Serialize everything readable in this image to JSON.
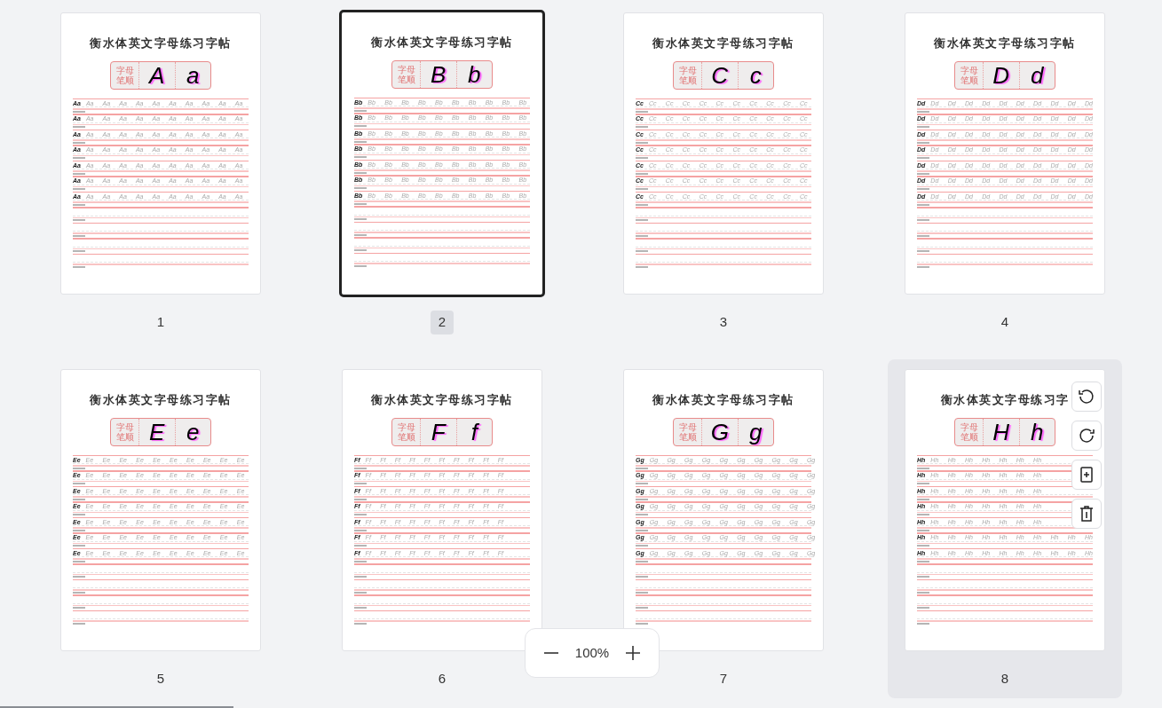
{
  "pages": [
    {
      "number": "1",
      "selected": false,
      "hovered": false,
      "title": "衡水体英文字母练习字帖",
      "stroke_label": [
        "字母",
        "笔顺"
      ],
      "upper": "A",
      "lower": "a",
      "rows": [
        {
          "model": "Aa",
          "traces": "Aa Aa Aa Aa Aa Aa Aa Aa Aa Aa"
        },
        {
          "model": "Aa",
          "traces": "Aa Aa Aa Aa Aa Aa Aa Aa Aa Aa"
        },
        {
          "model": "Aa",
          "traces": "Aa Aa Aa Aa Aa Aa Aa Aa Aa Aa"
        },
        {
          "model": "Aa",
          "traces": "Aa Aa Aa Aa Aa Aa Aa Aa Aa Aa"
        },
        {
          "model": "Aa",
          "traces": "Aa Aa Aa Aa Aa Aa Aa Aa Aa Aa"
        },
        {
          "model": "Aa",
          "traces": "Aa Aa Aa Aa Aa Aa Aa Aa Aa Aa"
        },
        {
          "model": "Aa",
          "traces": "Aa Aa Aa Aa Aa Aa Aa Aa Aa Aa"
        }
      ]
    },
    {
      "number": "2",
      "selected": true,
      "hovered": false,
      "title": "衡水体英文字母练习字帖",
      "stroke_label": [
        "字母",
        "笔顺"
      ],
      "upper": "B",
      "lower": "b",
      "rows": [
        {
          "model": "Bb",
          "traces": "Bb Bb Bb Bb Bb Bb Bb Bb Bb Bb"
        },
        {
          "model": "Bb",
          "traces": "Bb Bb Bb Bb Bb Bb Bb Bb Bb Bb"
        },
        {
          "model": "Bb",
          "traces": "Bb Bb Bb Bb Bb Bb Bb Bb Bb Bb"
        },
        {
          "model": "Bb",
          "traces": "Bb Bb Bb Bb Bb Bb Bb Bb Bb Bb"
        },
        {
          "model": "Bb",
          "traces": "Bb Bb Bb Bb Bb Bb Bb Bb Bb Bb"
        },
        {
          "model": "Bb",
          "traces": "Bb Bb Bb Bb Bb Bb Bb Bb Bb Bb"
        },
        {
          "model": "Bb",
          "traces": "Bb Bb Bb Bb Bb Bb Bb Bb Bb Bb"
        }
      ]
    },
    {
      "number": "3",
      "selected": false,
      "hovered": false,
      "title": "衡水体英文字母练习字帖",
      "stroke_label": [
        "字母",
        "笔顺"
      ],
      "upper": "C",
      "lower": "c",
      "rows": [
        {
          "model": "Cc",
          "traces": "Cc Cc Cc Cc Cc Cc Cc Cc Cc Cc"
        },
        {
          "model": "Cc",
          "traces": "Cc Cc Cc Cc Cc Cc Cc Cc Cc Cc"
        },
        {
          "model": "Cc",
          "traces": "Cc Cc Cc Cc Cc Cc Cc Cc Cc Cc"
        },
        {
          "model": "Cc",
          "traces": "Cc Cc Cc Cc Cc Cc Cc Cc Cc Cc"
        },
        {
          "model": "Cc",
          "traces": "Cc Cc Cc Cc Cc Cc Cc Cc Cc Cc"
        },
        {
          "model": "Cc",
          "traces": "Cc Cc Cc Cc Cc Cc Cc Cc Cc Cc"
        },
        {
          "model": "Cc",
          "traces": "Cc Cc Cc Cc Cc Cc Cc Cc Cc Cc"
        }
      ]
    },
    {
      "number": "4",
      "selected": false,
      "hovered": false,
      "title": "衡水体英文字母练习字帖",
      "stroke_label": [
        "字母",
        "笔顺"
      ],
      "upper": "D",
      "lower": "d",
      "rows": [
        {
          "model": "Dd",
          "traces": "Dd Dd Dd Dd Dd Dd Dd Dd Dd Dd"
        },
        {
          "model": "Dd",
          "traces": "Dd Dd Dd Dd Dd Dd Dd Dd Dd Dd"
        },
        {
          "model": "Dd",
          "traces": "Dd Dd Dd Dd Dd Dd Dd Dd Dd Dd"
        },
        {
          "model": "Dd",
          "traces": "Dd Dd Dd Dd Dd Dd Dd Dd Dd Dd"
        },
        {
          "model": "Dd",
          "traces": "Dd Dd Dd Dd Dd Dd Dd Dd Dd Dd"
        },
        {
          "model": "Dd",
          "traces": "Dd Dd Dd Dd Dd Dd Dd Dd Dd Dd"
        },
        {
          "model": "Dd",
          "traces": "Dd Dd Dd Dd Dd Dd Dd Dd Dd Dd"
        }
      ]
    },
    {
      "number": "5",
      "selected": false,
      "hovered": false,
      "title": "衡水体英文字母练习字帖",
      "stroke_label": [
        "字母",
        "笔顺"
      ],
      "upper": "E",
      "lower": "e",
      "rows": [
        {
          "model": "Ee",
          "traces": "Ee Ee Ee Ee Ee Ee Ee Ee Ee Ee"
        },
        {
          "model": "Ee",
          "traces": "Ee Ee Ee Ee Ee Ee Ee Ee Ee Ee"
        },
        {
          "model": "Ee",
          "traces": "Ee Ee Ee Ee Ee Ee Ee Ee Ee Ee"
        },
        {
          "model": "Ee",
          "traces": "Ee Ee Ee Ee Ee Ee Ee Ee Ee Ee"
        },
        {
          "model": "Ee",
          "traces": "Ee Ee Ee Ee Ee Ee Ee Ee Ee Ee"
        },
        {
          "model": "Ee",
          "traces": "Ee Ee Ee Ee Ee Ee Ee Ee Ee Ee"
        },
        {
          "model": "Ee",
          "traces": "Ee Ee Ee Ee Ee Ee Ee Ee Ee Ee"
        }
      ]
    },
    {
      "number": "6",
      "selected": false,
      "hovered": false,
      "title": "衡水体英文字母练习字帖",
      "stroke_label": [
        "字母",
        "笔顺"
      ],
      "upper": "F",
      "lower": "f",
      "rows": [
        {
          "model": "Ff",
          "traces": "Ff Ff Ff Ff Ff Ff Ff Ff Ff Ff"
        },
        {
          "model": "Ff",
          "traces": "Ff Ff Ff Ff Ff Ff Ff Ff Ff Ff"
        },
        {
          "model": "Ff",
          "traces": "Ff Ff Ff Ff Ff Ff Ff Ff Ff Ff"
        },
        {
          "model": "Ff",
          "traces": "Ff Ff Ff Ff Ff Ff Ff Ff Ff Ff"
        },
        {
          "model": "Ff",
          "traces": "Ff Ff Ff Ff Ff Ff Ff Ff Ff Ff"
        },
        {
          "model": "Ff",
          "traces": "Ff Ff Ff Ff Ff Ff Ff Ff Ff Ff"
        },
        {
          "model": "Ff",
          "traces": "Ff Ff Ff Ff Ff Ff Ff Ff Ff Ff"
        }
      ]
    },
    {
      "number": "7",
      "selected": false,
      "hovered": false,
      "title": "衡水体英文字母练习字帖",
      "stroke_label": [
        "字母",
        "笔顺"
      ],
      "upper": "G",
      "lower": "g",
      "rows": [
        {
          "model": "Gg",
          "traces": "Gg Gg Gg Gg Gg Gg Gg Gg Gg Gg"
        },
        {
          "model": "Gg",
          "traces": "Gg Gg Gg Gg Gg Gg Gg Gg Gg Gg"
        },
        {
          "model": "Gg",
          "traces": "Gg Gg Gg Gg Gg Gg Gg Gg Gg Gg"
        },
        {
          "model": "Gg",
          "traces": "Gg Gg Gg Gg Gg Gg Gg Gg Gg Gg"
        },
        {
          "model": "Gg",
          "traces": "Gg Gg Gg Gg Gg Gg Gg Gg Gg Gg"
        },
        {
          "model": "Gg",
          "traces": "Gg Gg Gg Gg Gg Gg Gg Gg Gg Gg"
        },
        {
          "model": "Gg",
          "traces": "Gg Gg Gg Gg Gg Gg Gg Gg Gg Gg"
        }
      ]
    },
    {
      "number": "8",
      "selected": false,
      "hovered": true,
      "title": "衡水体英文字母练习字",
      "stroke_label": [
        "字母",
        "笔顺"
      ],
      "upper": "H",
      "lower": "h",
      "rows": [
        {
          "model": "Hh",
          "traces": "Hh Hh Hh Hh Hh Hh Hh"
        },
        {
          "model": "Hh",
          "traces": "Hh Hh Hh Hh Hh Hh Hh"
        },
        {
          "model": "Hh",
          "traces": "Hh Hh Hh Hh Hh Hh Hh"
        },
        {
          "model": "Hh",
          "traces": "Hh Hh Hh Hh Hh Hh Hh"
        },
        {
          "model": "Hh",
          "traces": "Hh Hh Hh Hh Hh Hh Hh"
        },
        {
          "model": "Hh",
          "traces": "Hh Hh Hh Hh Hh Hh Hh Hh Hh Hh"
        },
        {
          "model": "Hh",
          "traces": "Hh Hh Hh Hh Hh Hh Hh Hh Hh Hh"
        }
      ],
      "tools": [
        {
          "kind": "rotate_left"
        },
        {
          "kind": "rotate_right"
        },
        {
          "kind": "insert_page"
        },
        {
          "kind": "delete"
        }
      ]
    }
  ],
  "zoom": {
    "value": "100%"
  }
}
